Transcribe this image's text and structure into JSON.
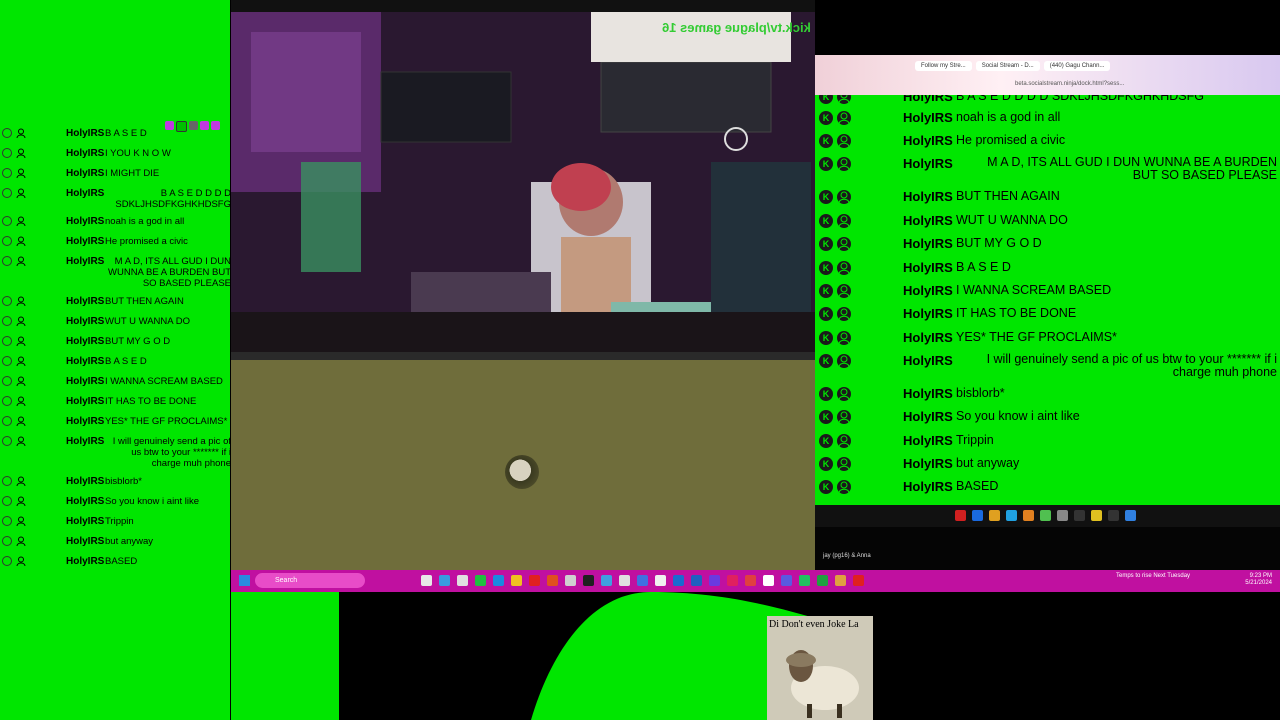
{
  "left_chat": {
    "messages": [
      {
        "user": "HolyIRS",
        "text": "B A S E D"
      },
      {
        "user": "HolyIRS",
        "text": "I YOU K N O W"
      },
      {
        "user": "HolyIRS",
        "text": "I MIGHT DIE"
      },
      {
        "user": "HolyIRS",
        "text": "B A S E D D D D SDKLJHSDFKGHKHDSFG"
      },
      {
        "user": "HolyIRS",
        "text": "noah is a god in all"
      },
      {
        "user": "HolyIRS",
        "text": "He promised a civic"
      },
      {
        "user": "HolyIRS",
        "text": "M A D, ITS ALL GUD I DUN WUNNA BE A BURDEN BUT SO BASED PLEASE"
      },
      {
        "user": "HolyIRS",
        "text": "BUT THEN AGAIN"
      },
      {
        "user": "HolyIRS",
        "text": "WUT U WANNA DO"
      },
      {
        "user": "HolyIRS",
        "text": "BUT MY G O D"
      },
      {
        "user": "HolyIRS",
        "text": "B A S E D"
      },
      {
        "user": "HolyIRS",
        "text": "I WANNA SCREAM BASED"
      },
      {
        "user": "HolyIRS",
        "text": "IT HAS TO BE DONE"
      },
      {
        "user": "HolyIRS",
        "text": "YES* THE GF PROCLAIMS*"
      },
      {
        "user": "HolyIRS",
        "text": "I will genuinely send a pic of us btw to your ******* if i charge muh phone"
      },
      {
        "user": "HolyIRS",
        "text": "bisblorb*"
      },
      {
        "user": "HolyIRS",
        "text": "So you know i aint like"
      },
      {
        "user": "HolyIRS",
        "text": "Trippin"
      },
      {
        "user": "HolyIRS",
        "text": "but anyway"
      },
      {
        "user": "HolyIRS",
        "text": "BASED"
      }
    ]
  },
  "video": {
    "overlay_text": "kick.tv/plague games 16"
  },
  "browser": {
    "tabs": [
      "Follow my Stre...",
      "Social Stream - D...",
      "(440) Gagu Chann..."
    ],
    "url": "beta.socialstream.ninja/dock.html?sess..."
  },
  "right_chat": {
    "messages": [
      {
        "user": "HolyIRS",
        "text": "B A S E D D D D SDKLJHSDFKGHKHDSFG"
      },
      {
        "user": "HolyIRS",
        "text": "noah is a god in all"
      },
      {
        "user": "HolyIRS",
        "text": "He promised a civic"
      },
      {
        "user": "HolyIRS",
        "text": "M A D, ITS ALL GUD I DUN WUNNA BE A BURDEN BUT SO BASED PLEASE"
      },
      {
        "user": "HolyIRS",
        "text": "BUT THEN AGAIN"
      },
      {
        "user": "HolyIRS",
        "text": "WUT U WANNA DO"
      },
      {
        "user": "HolyIRS",
        "text": "BUT MY G O D"
      },
      {
        "user": "HolyIRS",
        "text": "B A S E D"
      },
      {
        "user": "HolyIRS",
        "text": "I WANNA SCREAM BASED"
      },
      {
        "user": "HolyIRS",
        "text": "IT HAS TO BE DONE"
      },
      {
        "user": "HolyIRS",
        "text": "YES* THE GF PROCLAIMS*"
      },
      {
        "user": "HolyIRS",
        "text": "I will genuinely send a pic of us btw to your ******* if i charge muh phone"
      },
      {
        "user": "HolyIRS",
        "text": "bisblorb*"
      },
      {
        "user": "HolyIRS",
        "text": "So you know i aint like"
      },
      {
        "user": "HolyIRS",
        "text": "Trippin"
      },
      {
        "user": "HolyIRS",
        "text": "but anyway"
      },
      {
        "user": "HolyIRS",
        "text": "BASED"
      }
    ],
    "footer_label": "jay (pg16) & Anna"
  },
  "taskbar": {
    "search_placeholder": "Search",
    "news": "Temps to rise Next Tuesday",
    "time": "9:23 PM",
    "date": "5/21/2024"
  },
  "sheep_card": {
    "caption": "Di Don't even Joke La"
  },
  "colors": {
    "chroma_green": "#00e600",
    "taskbar": "#c010a0"
  }
}
